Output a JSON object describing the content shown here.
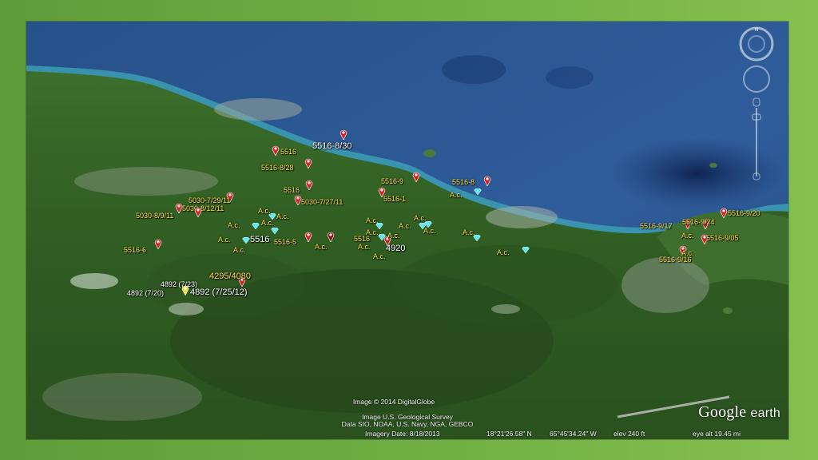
{
  "map": {
    "credits": {
      "line1": "Image © 2014 DigitalGlobe",
      "line2": "Image U.S. Geological Survey",
      "line3": "Data SIO, NOAA, U.S. Navy, NGA, GEBCO"
    },
    "status": {
      "imagery_date": "Imagery Date: 8/18/2013",
      "lat": "18°21'26.58\" N",
      "lon": "65°45'34.24\" W",
      "elev": "elev   240 ft",
      "eye_alt": "eye alt  19.45 mi"
    },
    "logo": {
      "word": "Google",
      "suffix": "earth"
    },
    "compass": {
      "north": "N"
    },
    "labels": {
      "l5516_830": "5516-8/30",
      "l5516_top": "5516",
      "l5516_828": "5516-8/28",
      "l5516_9": "5516-9",
      "l5516_8": "5516-8",
      "l5516_1": "5516-1",
      "l5516_a": "5516",
      "l5030_72911": "5030-7/29/11",
      "l5030_81211": "5030-8/12/11",
      "l5030_8911": "5030-8/9/11",
      "l5030_72711": "5030-7/27/11",
      "l5516_6": "5516-6",
      "l5516_5": "5516-5",
      "l5516_big": "5516",
      "l5516_mid": "5516",
      "l4920": "4920",
      "l4295": "4295/4080",
      "l4892_723": "4892 (7/23)",
      "l4892_720": "4892 (7/20)",
      "l4892_72512": "4892 (7/25/12)",
      "l5516_917": "5516-9/17",
      "l5516_924": "5516-9/24",
      "l5516_920": "5516-9/20",
      "l5516_905": "5516-9/05",
      "l5516_916": "5516-9/16",
      "ac": "A.c."
    }
  }
}
